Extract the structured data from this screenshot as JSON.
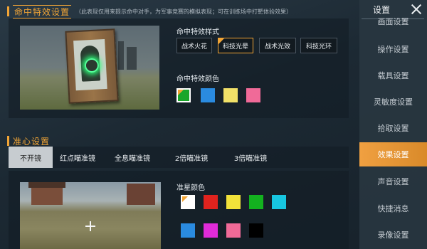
{
  "hit_effect": {
    "title": "命中特效设置",
    "subtitle": "（此表现仅用来提示命中对手，为军事竞赛的模拟表现；可在训练场中打靶体验效果）",
    "style_label": "命中特效样式",
    "styles": [
      {
        "label": "战术火花",
        "selected": false
      },
      {
        "label": "科技光晕",
        "selected": true
      },
      {
        "label": "战术光效",
        "selected": false
      },
      {
        "label": "科技光环",
        "selected": false
      }
    ],
    "color_label": "命中特效颜色",
    "colors": [
      {
        "color": "#1aa62a",
        "selected": true
      },
      {
        "color": "#2a8be0",
        "selected": false
      },
      {
        "color": "#f1e168",
        "selected": false
      },
      {
        "color": "#f06a98",
        "selected": false
      }
    ]
  },
  "crosshair": {
    "title": "准心设置",
    "tabs": [
      {
        "label": "不开镜",
        "active": true
      },
      {
        "label": "红点瞄准镜",
        "active": false
      },
      {
        "label": "全息瞄准镜",
        "active": false
      },
      {
        "label": "2倍瞄准镜",
        "active": false
      },
      {
        "label": "3倍瞄准镜",
        "active": false
      }
    ],
    "color_label": "准星颜色",
    "colors": [
      {
        "color": "#ffffff",
        "selected": true
      },
      {
        "color": "#e0231e",
        "selected": false
      },
      {
        "color": "#f2e23a",
        "selected": false
      },
      {
        "color": "#13b21f",
        "selected": false
      },
      {
        "color": "#17c6e0",
        "selected": false
      },
      {
        "color": "#2a8be0",
        "selected": false
      },
      {
        "color": "#e02bd8",
        "selected": false
      },
      {
        "color": "#f06a98",
        "selected": false
      },
      {
        "color": "#000000",
        "selected": false
      }
    ]
  },
  "sidebar": {
    "title": "设置",
    "items": [
      {
        "label": "画面设置",
        "active": false
      },
      {
        "label": "操作设置",
        "active": false
      },
      {
        "label": "载具设置",
        "active": false
      },
      {
        "label": "灵敏度设置",
        "active": false
      },
      {
        "label": "拾取设置",
        "active": false
      },
      {
        "label": "效果设置",
        "active": true
      },
      {
        "label": "声音设置",
        "active": false
      },
      {
        "label": "快捷消息",
        "active": false
      },
      {
        "label": "录像设置",
        "active": false
      }
    ]
  },
  "icons": {
    "close": "close-icon",
    "hit_marker": "target-hit-icon",
    "crosshair": "crosshair-icon"
  },
  "theme": {
    "accent": "#f2a536",
    "sidebar_active": "#e8953a"
  }
}
